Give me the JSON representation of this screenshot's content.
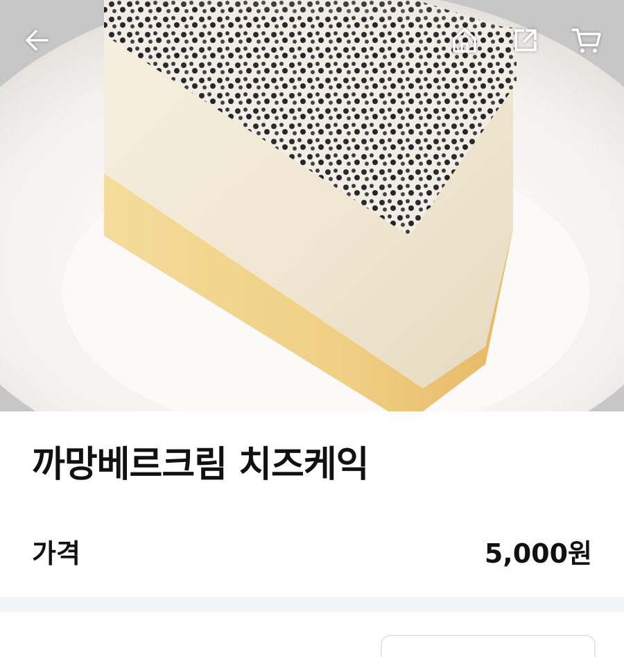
{
  "product": {
    "image_alt": "까망베르크림 치즈케익",
    "title": "까망베르크림 치즈케익"
  },
  "price": {
    "label": "가격",
    "value": "5,000원"
  },
  "topbar": {
    "icons": [
      "back-arrow-icon",
      "home-icon",
      "share-icon",
      "cart-icon"
    ],
    "icon_color": "#ffffff"
  }
}
